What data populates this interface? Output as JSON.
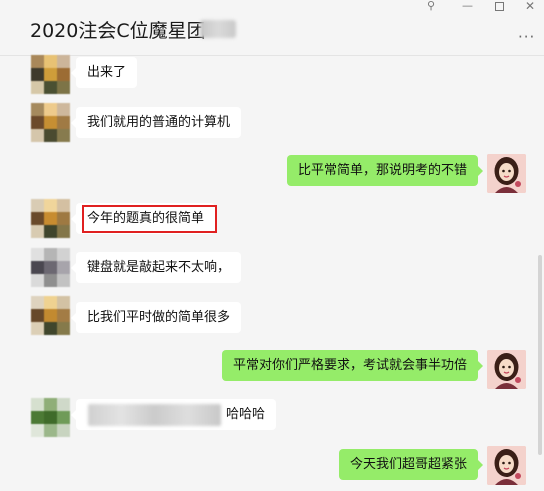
{
  "window": {
    "title": "2020注会C位魔星团",
    "pin_glyph": "⚲",
    "minimize_glyph": "—",
    "close_glyph": "✕",
    "more_glyph": "···"
  },
  "messages": [
    {
      "side": "left",
      "text": "出来了"
    },
    {
      "side": "left",
      "text": "我们就用的普通的计算机"
    },
    {
      "side": "right",
      "text": "比平常简单，那说明考的不错"
    },
    {
      "side": "left",
      "text": "今年的题真的很简单",
      "highlighted": true
    },
    {
      "side": "left",
      "text": "键盘就是敲起来不太响，"
    },
    {
      "side": "left",
      "text": "比我们平时做的简单很多"
    },
    {
      "side": "right",
      "text": "平常对你们严格要求，考试就会事半功倍"
    },
    {
      "side": "left",
      "text": "哈哈哈",
      "partially_obscured": true
    },
    {
      "side": "right",
      "text": "今天我们超哥超紧张"
    }
  ],
  "colors": {
    "incoming_bubble": "#ffffff",
    "outgoing_bubble": "#95ec69",
    "highlight_box": "#e02020",
    "background": "#f5f5f5"
  }
}
